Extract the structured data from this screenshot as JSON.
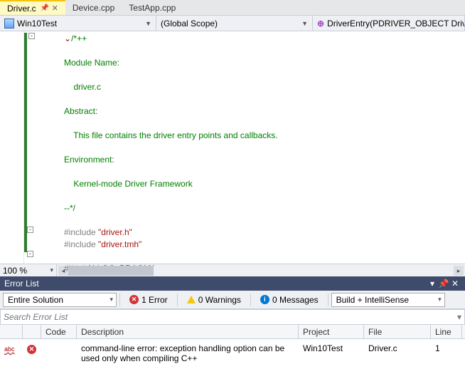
{
  "tabs": [
    {
      "label": "Driver.c",
      "active": true,
      "pinned": true
    },
    {
      "label": "Device.cpp",
      "active": false,
      "pinned": false
    },
    {
      "label": "TestApp.cpp",
      "active": false,
      "pinned": false
    }
  ],
  "nav": {
    "scope": "Win10Test",
    "global": "(Global Scope)",
    "func": "DriverEntry(PDRIVER_OBJECT Drive"
  },
  "code": {
    "l1": "/*++",
    "l2": "Module Name:",
    "l3": "    driver.c",
    "l4": "Abstract:",
    "l5": "    This file contains the driver entry points and callbacks.",
    "l6": "Environment:",
    "l7": "    Kernel-mode Driver Framework",
    "l8": "--*/",
    "inc1a": "#include ",
    "inc1b": "\"driver.h\"",
    "inc2a": "#include ",
    "inc2b": "\"driver.tmh\"",
    "ifdef_a": "#ifdef",
    "ifdef_b": " ALLOC_PRAGMA"
  },
  "zoom": "100 %",
  "errorPanel": {
    "title": "Error List",
    "scope": "Entire Solution",
    "errors": "1 Error",
    "warnings": "0 Warnings",
    "messages": "0 Messages",
    "mode": "Build + IntelliSense",
    "searchPlaceholder": "Search Error List",
    "columns": {
      "code": "Code",
      "desc": "Description",
      "proj": "Project",
      "file": "File",
      "line": "Line"
    },
    "rows": [
      {
        "code": "",
        "desc": "command-line error: exception handling option can be used only when compiling C++",
        "proj": "Win10Test",
        "file": "Driver.c",
        "line": "1"
      }
    ]
  }
}
